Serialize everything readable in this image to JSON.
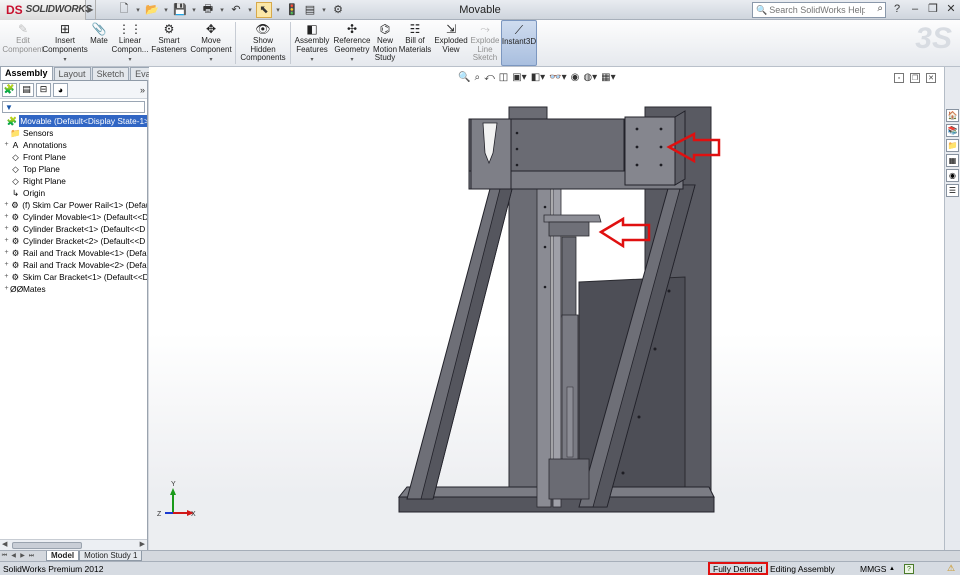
{
  "app": {
    "logo_text": "SOLIDWORKS",
    "logo_mark": "DS",
    "document_title": "Movable",
    "help_search_placeholder": "Search SolidWorks Help"
  },
  "quick_access": [
    {
      "name": "new-icon",
      "glyph": "🗋"
    },
    {
      "name": "open-icon",
      "glyph": "📂"
    },
    {
      "name": "save-icon",
      "glyph": "💾"
    },
    {
      "name": "print-icon",
      "glyph": "🖶"
    },
    {
      "name": "undo-icon",
      "glyph": "↶"
    },
    {
      "name": "select-icon",
      "glyph": "⬉"
    },
    {
      "name": "rebuild-icon",
      "glyph": "🚦"
    },
    {
      "name": "file-properties-icon",
      "glyph": "▤"
    },
    {
      "name": "options-icon",
      "glyph": "⚙"
    }
  ],
  "command_manager": [
    {
      "label": "Edit\nComponent",
      "icon": "✎",
      "disabled": true,
      "dropdown": false
    },
    {
      "label": "Insert\nComponents",
      "icon": "⊞",
      "disabled": false,
      "dropdown": true
    },
    {
      "label": "Mate",
      "icon": "📎",
      "disabled": false,
      "dropdown": false
    },
    {
      "label": "Linear\nCompon...",
      "icon": "⋮⋮",
      "disabled": false,
      "dropdown": true
    },
    {
      "label": "Smart\nFasteners",
      "icon": "⚙",
      "disabled": false,
      "dropdown": false
    },
    {
      "label": "Move\nComponent",
      "icon": "✥",
      "disabled": false,
      "dropdown": true
    },
    {
      "label": "Show\nHidden\nComponents",
      "icon": "👁",
      "disabled": false,
      "dropdown": false
    },
    {
      "label": "Assembly\nFeatures",
      "icon": "◧",
      "disabled": false,
      "dropdown": true
    },
    {
      "label": "Reference\nGeometry",
      "icon": "✣",
      "disabled": false,
      "dropdown": true
    },
    {
      "label": "New\nMotion\nStudy",
      "icon": "⌬",
      "disabled": false,
      "dropdown": false
    },
    {
      "label": "Bill of\nMaterials",
      "icon": "☷",
      "disabled": false,
      "dropdown": false
    },
    {
      "label": "Exploded\nView",
      "icon": "⇲",
      "disabled": false,
      "dropdown": false
    },
    {
      "label": "Explode\nLine\nSketch",
      "icon": "⤳",
      "disabled": true,
      "dropdown": false
    },
    {
      "label": "Instant3D",
      "icon": "⟋",
      "disabled": false,
      "dropdown": false,
      "active": true
    }
  ],
  "feature_manager": {
    "tabs": [
      "Assembly",
      "Layout",
      "Sketch",
      "Evaluate"
    ],
    "active_tab": "Assembly",
    "tree": [
      {
        "label": "Movable  (Default<Display State-1>)",
        "icon": "🧩",
        "indent": 0,
        "expander": "",
        "root": true
      },
      {
        "label": "Sensors",
        "icon": "📁",
        "indent": 1,
        "expander": ""
      },
      {
        "label": "Annotations",
        "icon": "A",
        "indent": 1,
        "expander": "+"
      },
      {
        "label": "Front Plane",
        "icon": "◇",
        "indent": 1,
        "expander": ""
      },
      {
        "label": "Top Plane",
        "icon": "◇",
        "indent": 1,
        "expander": ""
      },
      {
        "label": "Right Plane",
        "icon": "◇",
        "indent": 1,
        "expander": ""
      },
      {
        "label": "Origin",
        "icon": "↳",
        "indent": 1,
        "expander": ""
      },
      {
        "label": "(f) Skim Car Power Rail<1> (Defaul",
        "icon": "⚙",
        "indent": 1,
        "expander": "+"
      },
      {
        "label": "Cylinder Movable<1> (Default<<D",
        "icon": "⚙",
        "indent": 1,
        "expander": "+"
      },
      {
        "label": "Cylinder Bracket<1> (Default<<D",
        "icon": "⚙",
        "indent": 1,
        "expander": "+"
      },
      {
        "label": "Cylinder Bracket<2> (Default<<D",
        "icon": "⚙",
        "indent": 1,
        "expander": "+"
      },
      {
        "label": "Rail and Track Movable<1> (Defa",
        "icon": "⚙",
        "indent": 1,
        "expander": "+"
      },
      {
        "label": "Rail and Track Movable<2> (Defa",
        "icon": "⚙",
        "indent": 1,
        "expander": "+"
      },
      {
        "label": "Skim Car Bracket<1> (Default<<D",
        "icon": "⚙",
        "indent": 1,
        "expander": "+"
      },
      {
        "label": "Mates",
        "icon": "ØØ",
        "indent": 1,
        "expander": "+"
      }
    ]
  },
  "bottom_tabs": [
    "Model",
    "Motion Study 1"
  ],
  "active_bottom_tab": "Model",
  "status": {
    "product": "SolidWorks Premium 2012",
    "definition": "Fully Defined",
    "mode": "Editing Assembly",
    "units": "MMGS",
    "help_glyph": "?",
    "rebuild_glyph": "⚠"
  },
  "triad": {
    "x": "X",
    "y": "Y",
    "z": "Z"
  },
  "colors": {
    "selection": "#3166c4",
    "callout_red": "#e01010",
    "model_gray": "#5f6068"
  }
}
